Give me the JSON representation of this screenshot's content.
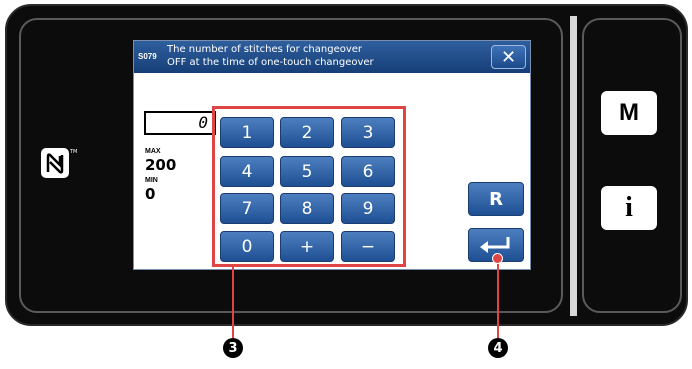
{
  "dialog": {
    "code": "S079",
    "title_line1": "The number of stitches for changeover",
    "title_line2": "OFF at the time of one-touch changeover",
    "close_icon": "close-icon"
  },
  "input": {
    "value": "0",
    "max_label": "MAX",
    "max_value": "200",
    "min_label": "MIN",
    "min_value": "0"
  },
  "keypad": {
    "keys": [
      "1",
      "2",
      "3",
      "4",
      "5",
      "6",
      "7",
      "8",
      "9",
      "0",
      "+",
      "−"
    ]
  },
  "actions": {
    "reset_label": "R",
    "enter_icon": "enter-arrow-icon"
  },
  "side_panel": {
    "mode_label": "M",
    "info_label": "i",
    "nfc_icon": "nfc-icon"
  },
  "callouts": {
    "numpad": "❸",
    "enter": "❹"
  },
  "colors": {
    "key_blue": "#2a5aa0",
    "title_blue": "#1f4c8a",
    "highlight_red": "#e04545"
  }
}
